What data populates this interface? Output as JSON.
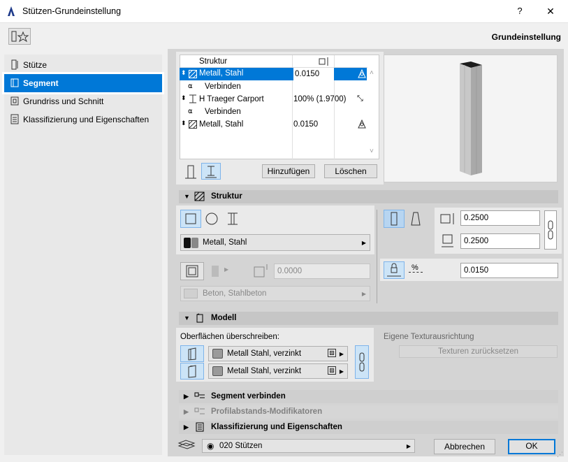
{
  "window": {
    "title": "Stützen-Grundeinstellung",
    "help": "?",
    "close": "✕"
  },
  "header": {
    "right_label": "Grundeinstellung"
  },
  "sidebar": {
    "items": [
      {
        "label": "Stütze",
        "icon": "column-icon"
      },
      {
        "label": "Segment",
        "icon": "segment-icon",
        "selected": true
      },
      {
        "label": "Grundriss und Schnitt",
        "icon": "floorplan-icon"
      },
      {
        "label": "Klassifizierung und Eigenschaften",
        "icon": "classification-icon"
      }
    ]
  },
  "structure_list": {
    "header": "Struktur",
    "rows": [
      {
        "name": "Metall, Stahl",
        "value": "0.0150",
        "selected": true
      },
      {
        "name": "Verbinden",
        "value": ""
      },
      {
        "name": "H Traeger Carport",
        "value": "100% (1.9700)"
      },
      {
        "name": "Verbinden",
        "value": ""
      },
      {
        "name": "Metall, Stahl",
        "value": "0.0150"
      }
    ],
    "add_button": "Hinzufügen",
    "delete_button": "Löschen"
  },
  "sections": {
    "struktur": "Struktur",
    "modell": "Modell",
    "segment_verbinden": "Segment verbinden",
    "profil": "Profilabstands-Modifikatoren",
    "klassifizierung": "Klassifizierung und Eigenschaften"
  },
  "struktur": {
    "material": "Metall, Stahl",
    "core_value": "0.0000",
    "core_material": "Beton, Stahlbeton",
    "width": "0.2500",
    "depth": "0.2500",
    "offset": "0.0150",
    "percent_symbol": "%"
  },
  "modell": {
    "override_label": "Oberflächen überschreiben:",
    "surface1": "Metall Stahl, verzinkt",
    "surface2": "Metall Stahl, verzinkt",
    "texture_label": "Eigene Texturausrichtung",
    "texture_button": "Texturen zurücksetzen"
  },
  "footer": {
    "layer": "020 Stützen",
    "cancel": "Abbrechen",
    "ok": "OK"
  },
  "colors": {
    "accent": "#0078d7"
  }
}
